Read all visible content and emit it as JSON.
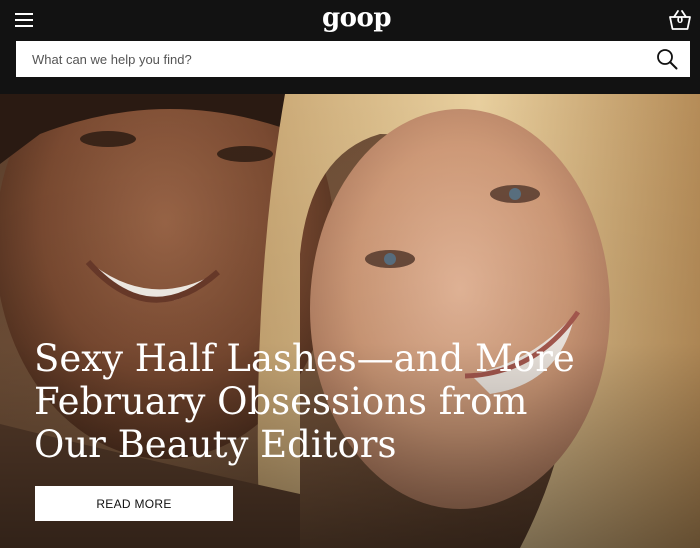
{
  "header": {
    "logo": "goop",
    "cart_count": "0"
  },
  "search": {
    "placeholder": "What can we help you find?"
  },
  "hero": {
    "headline": "Sexy Half Lashes—and More February Obsessions from Our Beauty Editors",
    "button_label": "READ MORE"
  },
  "icons": {
    "menu": "hamburger-menu-icon",
    "cart": "basket-icon",
    "search": "magnifier-icon"
  },
  "colors": {
    "header_bg": "#121212",
    "text_light": "#ffffff",
    "button_bg": "#ffffff"
  }
}
